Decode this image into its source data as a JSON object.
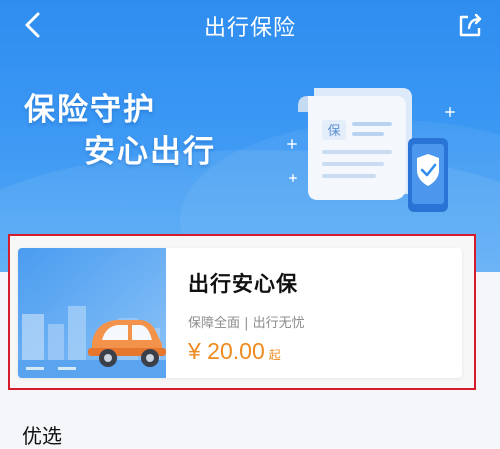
{
  "navbar": {
    "title": "出行保险"
  },
  "hero": {
    "slogan_line1": "保险守护",
    "slogan_line2": "安心出行",
    "doc_badge": "保"
  },
  "product": {
    "title": "出行安心保",
    "subtitle": "保障全面 | 出行无忧",
    "price": "¥ 20.00",
    "price_suffix": "起"
  },
  "section": {
    "title": "优选"
  },
  "colors": {
    "hero_blue": "#2f8df0",
    "price_orange": "#ef8a1f",
    "highlight_red": "#d51c2c"
  }
}
